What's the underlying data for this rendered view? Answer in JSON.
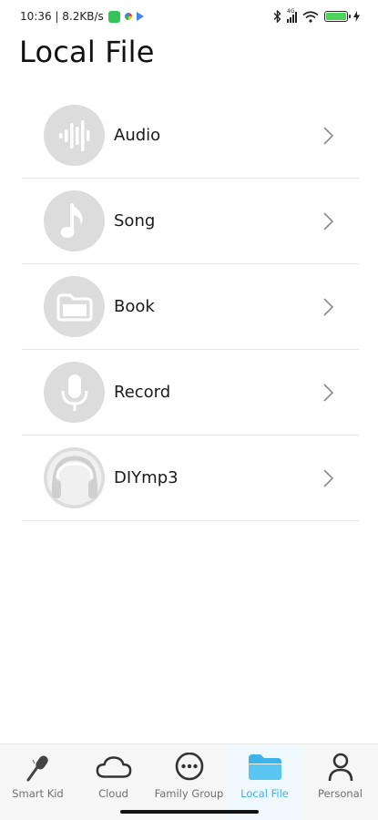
{
  "status_bar": {
    "time_speed": "10:36 | 8.2KB/s",
    "signal_label": "4G",
    "battery_level": 1.0,
    "icons": [
      "app-badge-icon",
      "photos-icon",
      "play-store-icon",
      "bluetooth-icon",
      "signal-icon",
      "wifi-icon",
      "battery-icon",
      "charging-icon"
    ]
  },
  "page": {
    "title": "Local File"
  },
  "list": {
    "items": [
      {
        "label": "Audio",
        "icon": "audio-waveform-icon"
      },
      {
        "label": "Song",
        "icon": "music-note-icon"
      },
      {
        "label": "Book",
        "icon": "folder-icon"
      },
      {
        "label": "Record",
        "icon": "microphone-icon"
      },
      {
        "label": "DIYmp3",
        "icon": "headphones-icon"
      }
    ]
  },
  "bottom_nav": {
    "items": [
      {
        "label": "Smart Kid",
        "icon": "microphone-pen-icon"
      },
      {
        "label": "Cloud",
        "icon": "cloud-icon"
      },
      {
        "label": "Family Group",
        "icon": "chat-bubble-icon"
      },
      {
        "label": "Local File",
        "icon": "folder-icon",
        "active": true
      },
      {
        "label": "Personal",
        "icon": "person-icon"
      }
    ]
  },
  "colors": {
    "accent": "#3eb3ea",
    "icon_circle": "#dcdcdc",
    "divider": "#e6e6e6"
  }
}
